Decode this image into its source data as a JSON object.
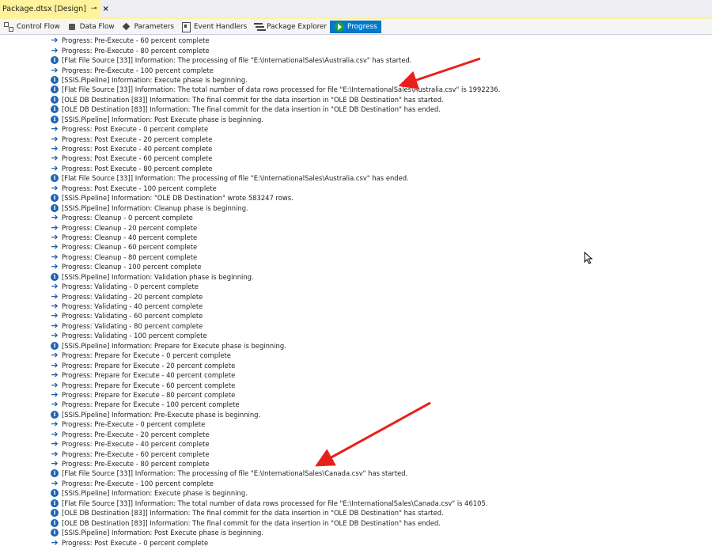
{
  "document_tab": {
    "title": "Package.dtsx [Design]",
    "pin": "⊸",
    "close": "×"
  },
  "designer_tabs": [
    {
      "label": "Control Flow",
      "icon": "control-flow-icon",
      "active": false
    },
    {
      "label": "Data Flow",
      "icon": "data-flow-icon",
      "active": false
    },
    {
      "label": "Parameters",
      "icon": "parameters-icon",
      "active": false
    },
    {
      "label": "Event Handlers",
      "icon": "event-handlers-icon",
      "active": false
    },
    {
      "label": "Package Explorer",
      "icon": "package-explorer-icon",
      "active": false
    },
    {
      "label": "Progress",
      "icon": "progress-icon",
      "active": true
    }
  ],
  "log_rows": [
    {
      "type": "progress",
      "text": "Progress: Pre-Execute - 60 percent complete"
    },
    {
      "type": "progress",
      "text": "Progress: Pre-Execute - 80 percent complete"
    },
    {
      "type": "info",
      "text": "[Flat File Source [33]] Information: The processing of file \"E:\\InternationalSales\\Australia.csv\" has started."
    },
    {
      "type": "progress",
      "text": "Progress: Pre-Execute - 100 percent complete"
    },
    {
      "type": "info",
      "text": "[SSIS.Pipeline] Information: Execute phase is beginning."
    },
    {
      "type": "info",
      "text": "[Flat File Source [33]] Information: The total number of data rows processed for file \"E:\\InternationalSales\\Australia.csv\" is 1992236."
    },
    {
      "type": "info",
      "text": "[OLE DB Destination [83]] Information: The final commit for the data insertion in \"OLE DB Destination\" has started."
    },
    {
      "type": "info",
      "text": "[OLE DB Destination [83]] Information: The final commit for the data insertion  in \"OLE DB Destination\" has ended."
    },
    {
      "type": "info",
      "text": "[SSIS.Pipeline] Information: Post Execute phase is beginning."
    },
    {
      "type": "progress",
      "text": "Progress: Post Execute - 0 percent complete"
    },
    {
      "type": "progress",
      "text": "Progress: Post Execute - 20 percent complete"
    },
    {
      "type": "progress",
      "text": "Progress: Post Execute - 40 percent complete"
    },
    {
      "type": "progress",
      "text": "Progress: Post Execute - 60 percent complete"
    },
    {
      "type": "progress",
      "text": "Progress: Post Execute - 80 percent complete"
    },
    {
      "type": "info",
      "text": "[Flat File Source [33]] Information: The processing of file \"E:\\InternationalSales\\Australia.csv\" has ended."
    },
    {
      "type": "progress",
      "text": "Progress: Post Execute - 100 percent complete"
    },
    {
      "type": "info",
      "text": "[SSIS.Pipeline] Information: \"OLE DB Destination\" wrote 583247 rows."
    },
    {
      "type": "info",
      "text": "[SSIS.Pipeline] Information: Cleanup phase is beginning."
    },
    {
      "type": "progress",
      "text": "Progress: Cleanup - 0 percent complete"
    },
    {
      "type": "progress",
      "text": "Progress: Cleanup - 20 percent complete"
    },
    {
      "type": "progress",
      "text": "Progress: Cleanup - 40 percent complete"
    },
    {
      "type": "progress",
      "text": "Progress: Cleanup - 60 percent complete"
    },
    {
      "type": "progress",
      "text": "Progress: Cleanup - 80 percent complete"
    },
    {
      "type": "progress",
      "text": "Progress: Cleanup - 100 percent complete"
    },
    {
      "type": "info",
      "text": "[SSIS.Pipeline] Information: Validation phase is beginning."
    },
    {
      "type": "progress",
      "text": "Progress: Validating - 0 percent complete"
    },
    {
      "type": "progress",
      "text": "Progress: Validating - 20 percent complete"
    },
    {
      "type": "progress",
      "text": "Progress: Validating - 40 percent complete"
    },
    {
      "type": "progress",
      "text": "Progress: Validating - 60 percent complete"
    },
    {
      "type": "progress",
      "text": "Progress: Validating - 80 percent complete"
    },
    {
      "type": "progress",
      "text": "Progress: Validating - 100 percent complete"
    },
    {
      "type": "info",
      "text": "[SSIS.Pipeline] Information: Prepare for Execute phase is beginning."
    },
    {
      "type": "progress",
      "text": "Progress: Prepare for Execute - 0 percent complete"
    },
    {
      "type": "progress",
      "text": "Progress: Prepare for Execute - 20 percent complete"
    },
    {
      "type": "progress",
      "text": "Progress: Prepare for Execute - 40 percent complete"
    },
    {
      "type": "progress",
      "text": "Progress: Prepare for Execute - 60 percent complete"
    },
    {
      "type": "progress",
      "text": "Progress: Prepare for Execute - 80 percent complete"
    },
    {
      "type": "progress",
      "text": "Progress: Prepare for Execute - 100 percent complete"
    },
    {
      "type": "info",
      "text": "[SSIS.Pipeline] Information: Pre-Execute phase is beginning."
    },
    {
      "type": "progress",
      "text": "Progress: Pre-Execute - 0 percent complete"
    },
    {
      "type": "progress",
      "text": "Progress: Pre-Execute - 20 percent complete"
    },
    {
      "type": "progress",
      "text": "Progress: Pre-Execute - 40 percent complete"
    },
    {
      "type": "progress",
      "text": "Progress: Pre-Execute - 60 percent complete"
    },
    {
      "type": "progress",
      "text": "Progress: Pre-Execute - 80 percent complete"
    },
    {
      "type": "info",
      "text": "[Flat File Source [33]] Information: The processing of file \"E:\\InternationalSales\\Canada.csv\" has started."
    },
    {
      "type": "progress",
      "text": "Progress: Pre-Execute - 100 percent complete"
    },
    {
      "type": "info",
      "text": "[SSIS.Pipeline] Information: Execute phase is beginning."
    },
    {
      "type": "info",
      "text": "[Flat File Source [33]] Information: The total number of data rows processed for file \"E:\\InternationalSales\\Canada.csv\" is 46105."
    },
    {
      "type": "info",
      "text": "[OLE DB Destination [83]] Information: The final commit for the data insertion in \"OLE DB Destination\" has started."
    },
    {
      "type": "info",
      "text": "[OLE DB Destination [83]] Information: The final commit for the data insertion  in \"OLE DB Destination\" has ended."
    },
    {
      "type": "info",
      "text": "[SSIS.Pipeline] Information: Post Execute phase is beginning."
    },
    {
      "type": "progress",
      "text": "Progress: Post Execute - 0 percent complete"
    }
  ],
  "glyphs": {
    "progress": "➔",
    "info": "i"
  },
  "colors": {
    "tab_yellow": "#fff29d",
    "active_blue": "#007acc",
    "annotation_red": "#e8201a",
    "progress_arrow": "#1b5fa8",
    "info_blue": "#1c63b7"
  }
}
